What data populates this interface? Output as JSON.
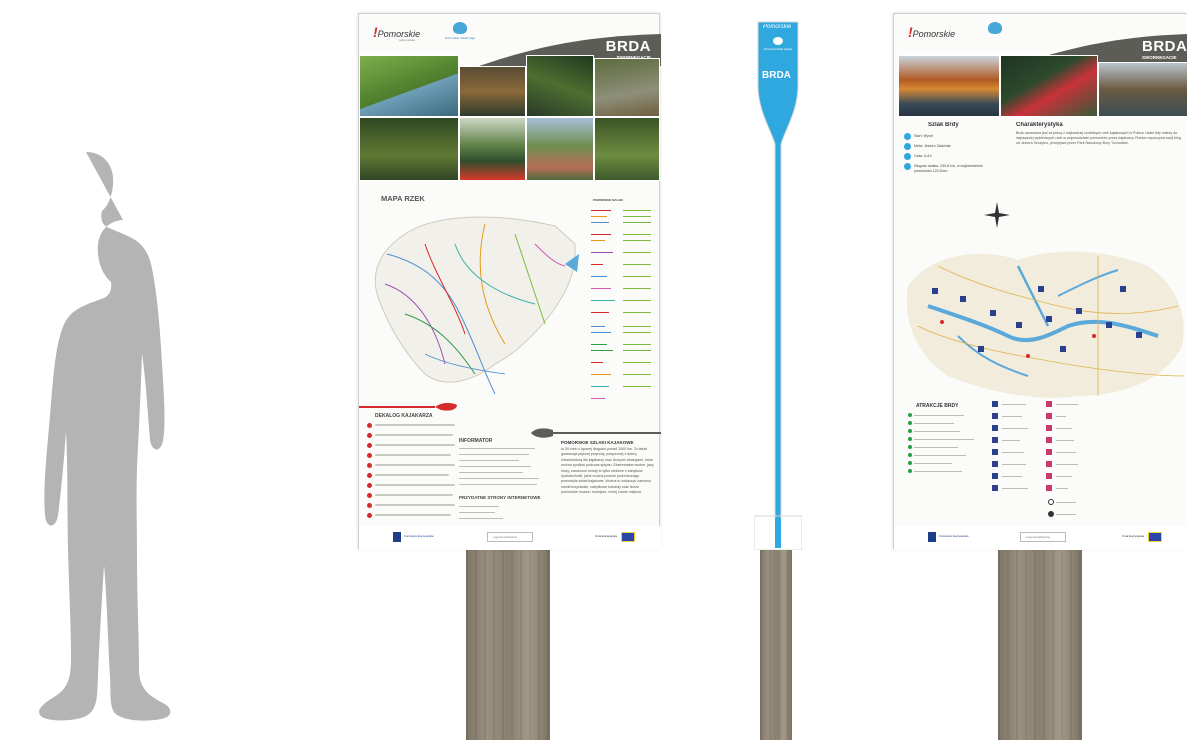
{
  "brand": {
    "logo_text": "Pomorskie",
    "logo_tagline": "turist polsko",
    "icon_label": "Pomorskie Szlaki Kajakowe"
  },
  "board_left": {
    "title": "BRDA",
    "subtitle": "SWORNEGACIE",
    "map_heading": "MAPA RZEK",
    "dekalog_heading": "DEKALOG KAJAKARZA",
    "informator_heading": "INFORMATOR",
    "links_heading": "PRZYDATNE STRONY INTERNETOWE",
    "intro_lead": "POMORSKIE SZLAKI KAJAKOWE",
    "intro_text": "to 39 rzek o łącznej długości ponad 1500 km. To także gwarancja pięknej przyrody, połączonej z dobrą infrastrukturą dla kajakarzy oraz licznymi atrakcjami, które można spotkać podczas spływu. Ekstremalne wodne, jazy, śluzy, zwodzone mosty to tylko niektóre z zabytków hydrotechniki, jakie można poznać przemierzając pomorskie szlaki kajakowe. Można tu zobaczyć zarówno zamki krzyżackie, zabytkowe kościoły oraz liczne pomorskie muzea i mniejsze, mniej znane miejsca.",
    "legend_title": "POMORSKIE SZLAKI",
    "sponsor_left": "Fundusze Europejskie",
    "sponsor_center": "Logo beneficjenta",
    "sponsor_right": "Unia Europejska"
  },
  "paddle": {
    "title": "BRDA",
    "icon_label": "Pomorskie Szlaki Kajakowe"
  },
  "board_right": {
    "title": "BRDA",
    "subtitle": "SWORNEGACIE",
    "left_heading": "Szlak Brdy",
    "items": [
      "Start: Wyrof",
      "Meta: Jezioro Ośdzioła",
      "Czas: 6-8 h",
      "Długość szlaku: 230,8 km, w województwie pomorskim 120,8 km"
    ],
    "right_heading": "Charakterystyka",
    "right_text": "Brda uznawana jest za jedną z najbardziej urokliwych rzek kajakowych w Polsce i stale bity należy do najczęściej wybieranych rzek w województwie pomorskim przez kajakarzy. Rzeka rozpoczyna swój bieg od Jeziora Szczytno, przepływa przez Park Narodowy Bory Tucholskie.",
    "attractions_heading": "ATRAKCJE BRDY",
    "sponsor_left": "Fundusze Europejskie",
    "sponsor_center": "Logo beneficjenta",
    "sponsor_right": "Unia Europejska"
  },
  "colors": {
    "accent_red": "#d62b2b",
    "paddle_blue": "#2fa7df",
    "header_gray": "#5d5d57"
  }
}
